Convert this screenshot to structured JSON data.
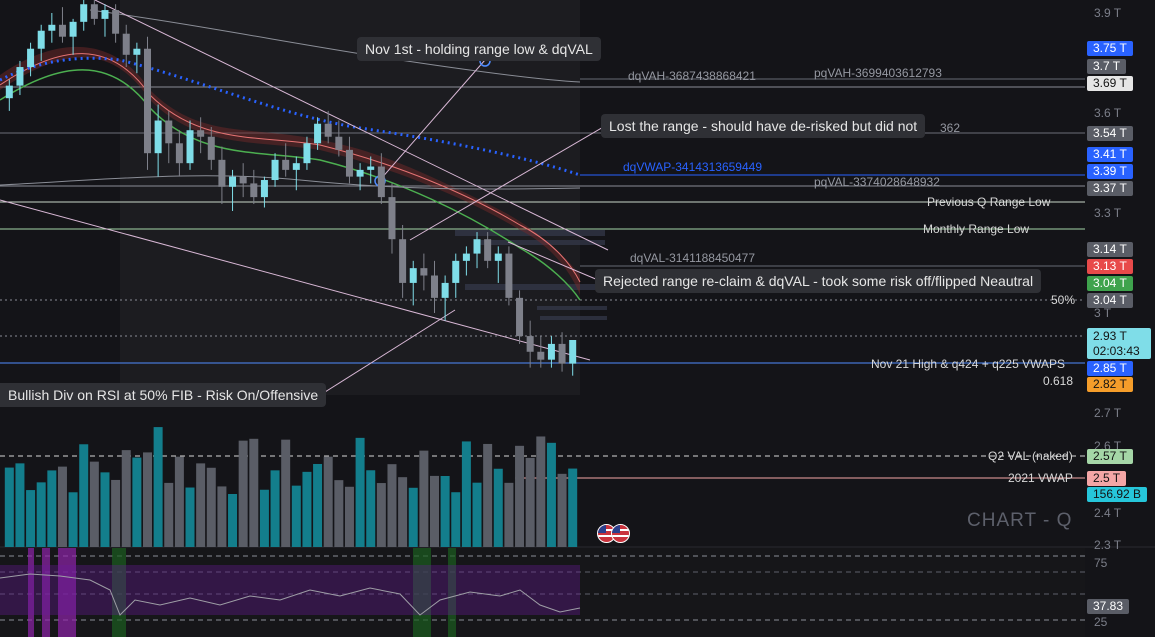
{
  "watermark": "CHART - Q",
  "annotations": {
    "nov1": "Nov 1st - holding range low & dqVAL",
    "lost_range": "Lost the range - should have de-risked but did not",
    "rejected": "Rejected range re-claim & dqVAL - took some risk off/flipped Neautral",
    "bullish_div": "Bullish Div on RSI at 50% FIB - Risk On/Offensive"
  },
  "line_labels": {
    "dqvah": "dqVAH-3687438868421",
    "pqvah": "pqVAH-3699403612793",
    "dqvwap": "dqVWAP-3414313659449",
    "pqval": "pqVAL-3374028648932",
    "partial_362": "362",
    "dqval": "dqVAL-3141188450477",
    "prev_q_range_low": "Previous Q Range Low",
    "monthly_range_low": "Monthly Range Low",
    "fib_50": "50%",
    "nov21": "Nov 21 High & q424 + q225 VWAPS",
    "fib_618": "0.618",
    "q2_val": "Q2 VAL (naked)",
    "vwap_2021": "2021 VWAP"
  },
  "price_axis_ticks": [
    "3.9 T",
    "3.6 T",
    "3.3 T",
    "3 T",
    "2.7 T",
    "2.6 T",
    "2.4 T",
    "2.3 T"
  ],
  "rsi_axis_ticks": [
    "75",
    "25"
  ],
  "price_tags": [
    {
      "id": "t375",
      "text": "3.75 T",
      "bg": "#2962ff",
      "fg": "#ffffff"
    },
    {
      "id": "t37",
      "text": "3.7 T",
      "bg": "#5a5d66",
      "fg": "#ffffff"
    },
    {
      "id": "t369",
      "text": "3.69 T",
      "bg": "#e6e6e6",
      "fg": "#131313"
    },
    {
      "id": "t354",
      "text": "3.54 T",
      "bg": "#5a5d66",
      "fg": "#ffffff"
    },
    {
      "id": "t341",
      "text": "3.41 T",
      "bg": "#2962ff",
      "fg": "#ffffff"
    },
    {
      "id": "t339",
      "text": "3.39 T",
      "bg": "#2962ff",
      "fg": "#ffffff"
    },
    {
      "id": "t337",
      "text": "3.37 T",
      "bg": "#5a5d66",
      "fg": "#ffffff"
    },
    {
      "id": "t314",
      "text": "3.14 T",
      "bg": "#5a5d66",
      "fg": "#ffffff"
    },
    {
      "id": "t313",
      "text": "3.13 T",
      "bg": "#e84a4a",
      "fg": "#ffffff"
    },
    {
      "id": "t304g",
      "text": "3.04 T",
      "bg": "#3fa34d",
      "fg": "#ffffff"
    },
    {
      "id": "t304",
      "text": "3.04 T",
      "bg": "#5a5d66",
      "fg": "#ffffff"
    },
    {
      "id": "t293",
      "text": "2.93 T",
      "bg": "#7fdde8",
      "fg": "#131313"
    },
    {
      "id": "t285",
      "text": "2.85 T",
      "bg": "#2962ff",
      "fg": "#ffffff"
    },
    {
      "id": "t282",
      "text": "2.82 T",
      "bg": "#f59d2a",
      "fg": "#131313"
    },
    {
      "id": "t257",
      "text": "2.57 T",
      "bg": "#a5d6a7",
      "fg": "#131313"
    },
    {
      "id": "t25",
      "text": "2.5 T",
      "bg": "#f4a6a6",
      "fg": "#131313"
    },
    {
      "id": "tvol",
      "text": "156.92 B",
      "bg": "#26c6da",
      "fg": "#131313"
    },
    {
      "id": "trsi",
      "text": "37.83",
      "bg": "#5a5d66",
      "fg": "#ffffff"
    }
  ],
  "countdown": "02:03:43",
  "chart_data": {
    "type": "candlestick",
    "y_unit": "T",
    "y_scale": "log",
    "ylim": [
      2.3,
      3.95
    ],
    "candles_approx": [
      [
        3.62,
        3.68,
        3.58,
        3.66
      ],
      [
        3.66,
        3.74,
        3.63,
        3.72
      ],
      [
        3.72,
        3.8,
        3.69,
        3.78
      ],
      [
        3.78,
        3.86,
        3.74,
        3.84
      ],
      [
        3.84,
        3.9,
        3.8,
        3.86
      ],
      [
        3.86,
        3.92,
        3.8,
        3.82
      ],
      [
        3.82,
        3.88,
        3.76,
        3.87
      ],
      [
        3.87,
        3.95,
        3.84,
        3.93
      ],
      [
        3.93,
        3.95,
        3.86,
        3.88
      ],
      [
        3.88,
        3.93,
        3.82,
        3.91
      ],
      [
        3.91,
        3.93,
        3.8,
        3.83
      ],
      [
        3.83,
        3.86,
        3.72,
        3.76
      ],
      [
        3.76,
        3.8,
        3.7,
        3.78
      ],
      [
        3.78,
        3.82,
        3.4,
        3.45
      ],
      [
        3.45,
        3.6,
        3.38,
        3.55
      ],
      [
        3.55,
        3.58,
        3.42,
        3.48
      ],
      [
        3.48,
        3.52,
        3.38,
        3.42
      ],
      [
        3.42,
        3.55,
        3.4,
        3.52
      ],
      [
        3.52,
        3.56,
        3.45,
        3.5
      ],
      [
        3.5,
        3.53,
        3.4,
        3.43
      ],
      [
        3.43,
        3.47,
        3.3,
        3.35
      ],
      [
        3.35,
        3.4,
        3.28,
        3.38
      ],
      [
        3.38,
        3.42,
        3.32,
        3.36
      ],
      [
        3.36,
        3.4,
        3.3,
        3.32
      ],
      [
        3.32,
        3.38,
        3.29,
        3.37
      ],
      [
        3.37,
        3.45,
        3.35,
        3.43
      ],
      [
        3.43,
        3.48,
        3.38,
        3.4
      ],
      [
        3.4,
        3.44,
        3.34,
        3.42
      ],
      [
        3.42,
        3.5,
        3.4,
        3.48
      ],
      [
        3.48,
        3.56,
        3.46,
        3.54
      ],
      [
        3.54,
        3.58,
        3.48,
        3.5
      ],
      [
        3.5,
        3.55,
        3.44,
        3.46
      ],
      [
        3.46,
        3.5,
        3.36,
        3.38
      ],
      [
        3.38,
        3.42,
        3.34,
        3.4
      ],
      [
        3.4,
        3.44,
        3.36,
        3.41
      ],
      [
        3.41,
        3.45,
        3.3,
        3.32
      ],
      [
        3.32,
        3.36,
        3.16,
        3.2
      ],
      [
        3.2,
        3.24,
        3.04,
        3.08
      ],
      [
        3.08,
        3.14,
        3.02,
        3.12
      ],
      [
        3.12,
        3.16,
        3.06,
        3.1
      ],
      [
        3.1,
        3.14,
        3.0,
        3.04
      ],
      [
        3.04,
        3.1,
        2.98,
        3.08
      ],
      [
        3.08,
        3.16,
        3.04,
        3.14
      ],
      [
        3.14,
        3.18,
        3.1,
        3.16
      ],
      [
        3.16,
        3.22,
        3.12,
        3.2
      ],
      [
        3.2,
        3.22,
        3.12,
        3.14
      ],
      [
        3.14,
        3.18,
        3.08,
        3.16
      ],
      [
        3.16,
        3.18,
        3.02,
        3.04
      ],
      [
        3.04,
        3.06,
        2.92,
        2.94
      ],
      [
        2.94,
        2.98,
        2.86,
        2.9
      ],
      [
        2.9,
        2.94,
        2.86,
        2.88
      ],
      [
        2.88,
        2.94,
        2.86,
        2.92
      ],
      [
        2.92,
        2.95,
        2.85,
        2.87
      ],
      [
        2.87,
        2.93,
        2.84,
        2.93
      ]
    ]
  }
}
